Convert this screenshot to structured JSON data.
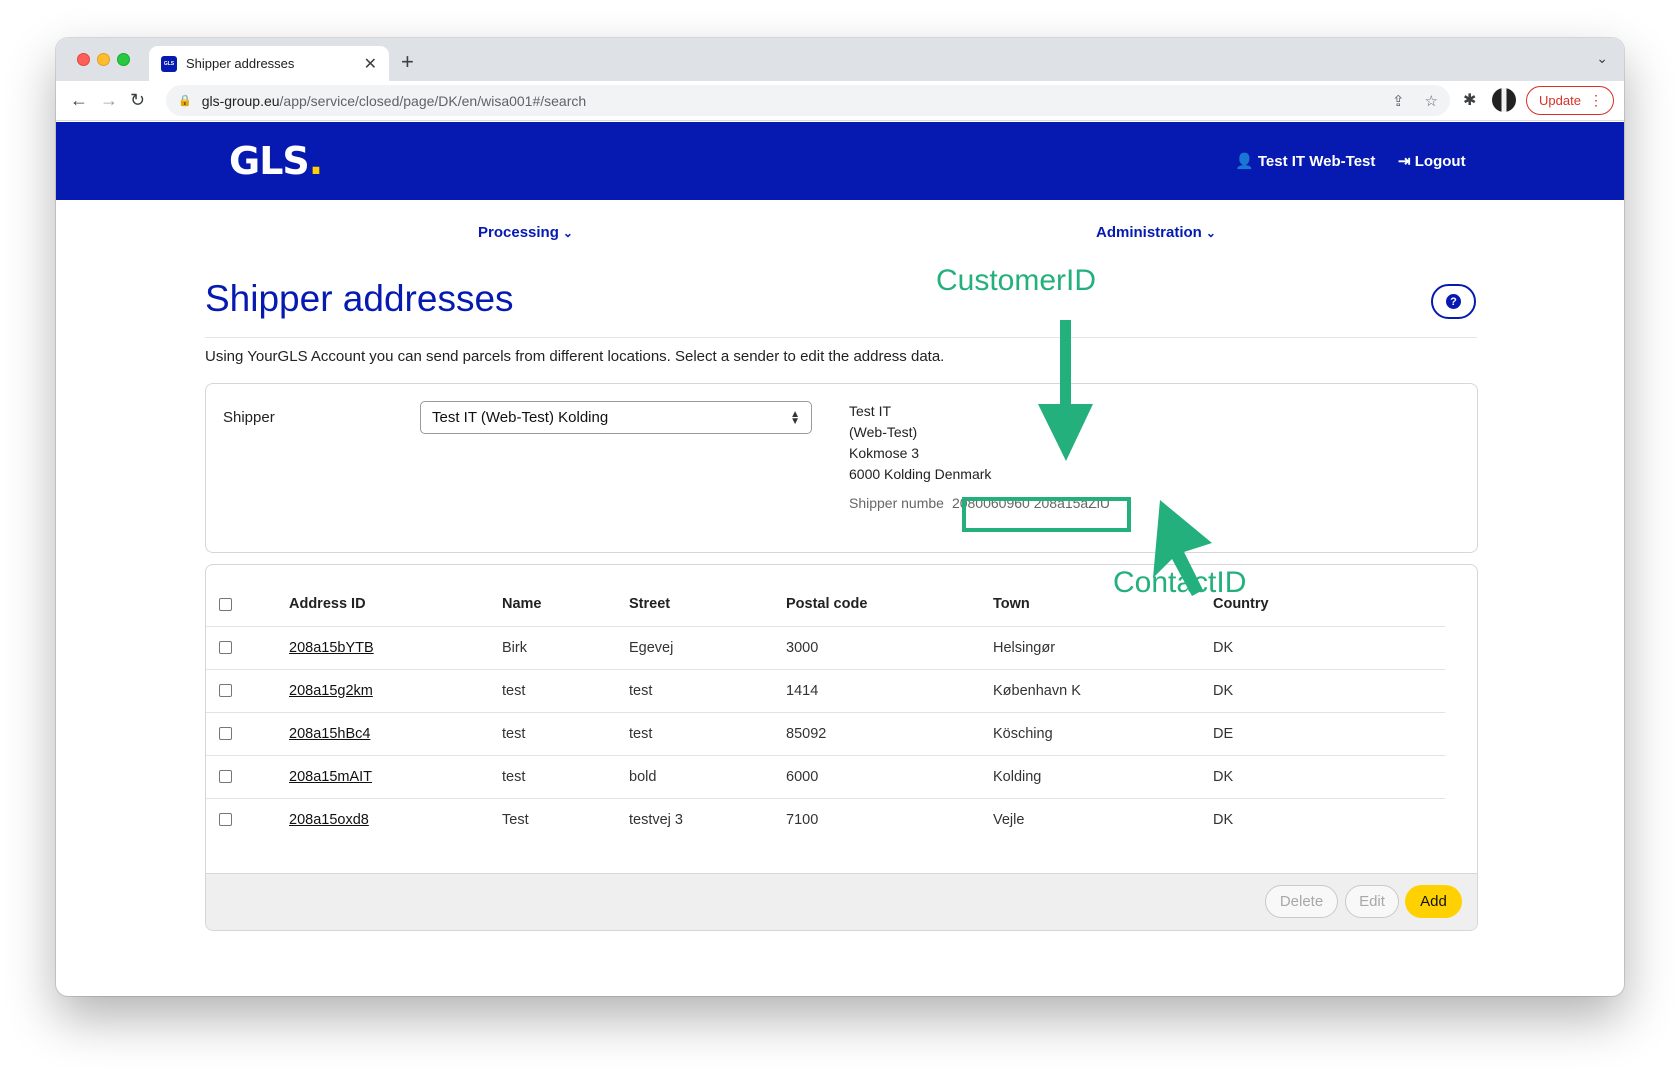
{
  "browser": {
    "tab_title": "Shipper addresses",
    "url_host": "gls-group.eu",
    "url_path": "/app/service/closed/page/DK/en/wisa001#/search",
    "update_label": "Update"
  },
  "header": {
    "logo_text": "GLS",
    "user_label": "Test IT Web-Test",
    "logout_label": "Logout"
  },
  "menu": {
    "processing": "Processing",
    "administration": "Administration"
  },
  "page": {
    "title": "Shipper addresses",
    "intro": "Using YourGLS Account you can send parcels from different locations. Select a sender to edit the address data."
  },
  "shipper": {
    "label": "Shipper",
    "selected": "Test IT (Web-Test) Kolding",
    "address_lines": [
      "Test IT",
      "(Web-Test)",
      "Kokmose 3",
      "6000 Kolding Denmark"
    ],
    "number_label": "Shipper numbe",
    "number_value": "2080060960 208a15aZlU"
  },
  "annotations": {
    "customer_id": "CustomerID",
    "contact_id": "ContactID",
    "color": "#23b07d"
  },
  "table": {
    "columns": [
      "Address ID",
      "Name",
      "Street",
      "Postal code",
      "Town",
      "Country"
    ],
    "rows": [
      [
        "208a15bYTB",
        "Birk",
        "Egevej",
        "3000",
        "Helsingør",
        "DK"
      ],
      [
        "208a15g2km",
        "test",
        "test",
        "1414",
        "København K",
        "DK"
      ],
      [
        "208a15hBc4",
        "test",
        "test",
        "85092",
        "Kösching",
        "DE"
      ],
      [
        "208a15mAIT",
        "test",
        "bold",
        "6000",
        "Kolding",
        "DK"
      ],
      [
        "208a15oxd8",
        "Test",
        "testvej 3",
        "7100",
        "Vejle",
        "DK"
      ]
    ]
  },
  "actions": {
    "delete": "Delete",
    "edit": "Edit",
    "add": "Add"
  },
  "colors": {
    "brand_blue": "#061ab1",
    "brand_yellow": "#ffd100"
  }
}
